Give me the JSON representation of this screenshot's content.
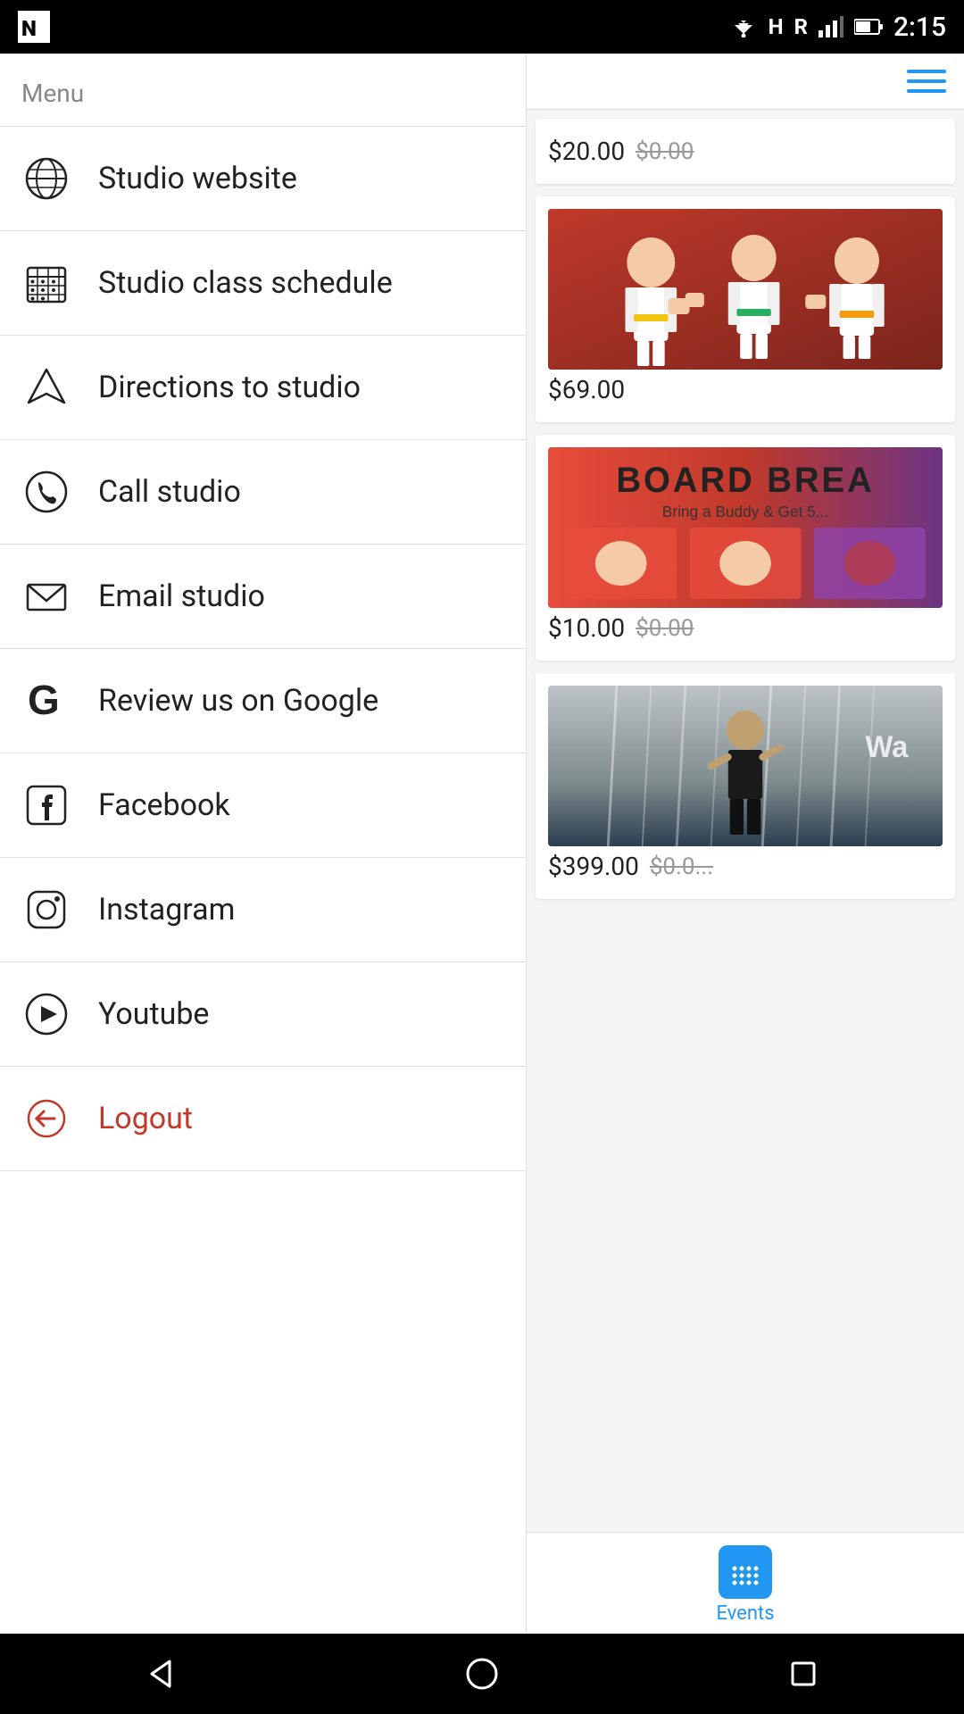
{
  "statusBar": {
    "time": "2:15",
    "logo": "N"
  },
  "menu": {
    "title": "Menu",
    "items": [
      {
        "id": "studio-website",
        "label": "Studio website",
        "icon": "globe"
      },
      {
        "id": "studio-class-schedule",
        "label": "Studio class schedule",
        "icon": "calendar-grid"
      },
      {
        "id": "directions-to-studio",
        "label": "Directions to studio",
        "icon": "navigation"
      },
      {
        "id": "call-studio",
        "label": "Call studio",
        "icon": "phone"
      },
      {
        "id": "email-studio",
        "label": "Email studio",
        "icon": "mail"
      },
      {
        "id": "review-google",
        "label": "Review us on Google",
        "icon": "google"
      },
      {
        "id": "facebook",
        "label": "Facebook",
        "icon": "facebook"
      },
      {
        "id": "instagram",
        "label": "Instagram",
        "icon": "instagram"
      },
      {
        "id": "youtube",
        "label": "Youtube",
        "icon": "youtube"
      },
      {
        "id": "logout",
        "label": "Logout",
        "icon": "logout",
        "special": "logout"
      }
    ]
  },
  "rightPanel": {
    "products": [
      {
        "id": "p1",
        "priceMain": "$20.00",
        "priceStrike": "$0.00",
        "type": "price-only"
      },
      {
        "id": "p2",
        "priceMain": "$69.00",
        "priceStrike": "",
        "type": "kids-karate"
      },
      {
        "id": "p3",
        "priceMain": "$10.00",
        "priceStrike": "$0.00",
        "type": "board-break",
        "title": "BOARD BREA...",
        "sub": "Bring a Buddy & Get 5..."
      },
      {
        "id": "p4",
        "priceMain": "$399.00",
        "priceStrike": "$0.0...",
        "type": "warrior"
      }
    ]
  },
  "bottomTab": {
    "label": "Events"
  },
  "navBar": {
    "back": "◁",
    "home": "○",
    "recent": "□"
  }
}
